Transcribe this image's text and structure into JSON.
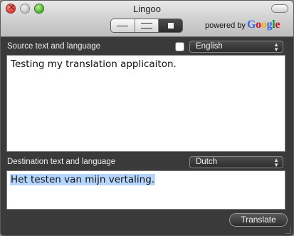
{
  "window": {
    "title": "Lingoo"
  },
  "toolbar": {
    "powered_by": "powered by",
    "brand": {
      "text": "Google",
      "letter_colors": [
        "#3369e8",
        "#d50f25",
        "#eeb211",
        "#3369e8",
        "#009925",
        "#d50f25"
      ]
    },
    "view_modes": [
      {
        "icon": "single-line-icon",
        "selected": false
      },
      {
        "icon": "double-line-icon",
        "selected": false
      },
      {
        "icon": "square-icon",
        "selected": true
      }
    ]
  },
  "source": {
    "label": "Source text and language",
    "auto_detect_checked": false,
    "language": "English",
    "text": "Testing my translation applicaiton."
  },
  "destination": {
    "label": "Destination text and language",
    "language": "Dutch",
    "text": "Het testen van mijn vertaling."
  },
  "actions": {
    "translate_label": "Translate"
  },
  "colors": {
    "window_bg": "#3a3a3a",
    "selection": "#b5d5fd",
    "close": "#e0443a",
    "zoom": "#5fbf3a"
  }
}
